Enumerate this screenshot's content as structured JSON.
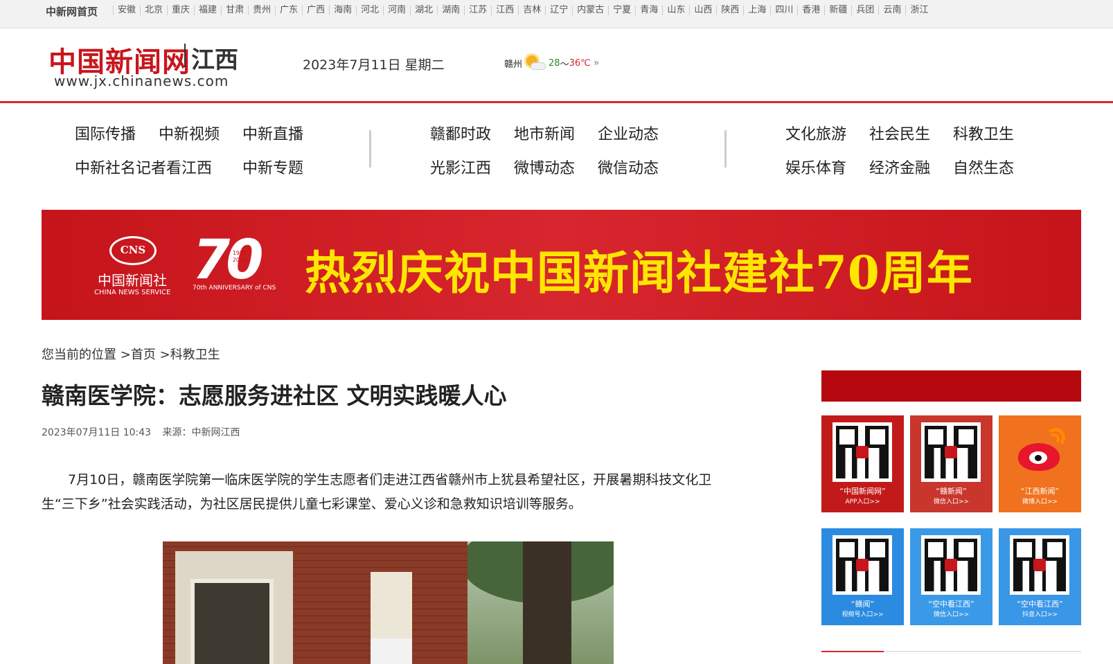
{
  "topbar": {
    "home_label": "中新网首页",
    "provinces": [
      "安徽",
      "北京",
      "重庆",
      "福建",
      "甘肃",
      "贵州",
      "广东",
      "广西",
      "海南",
      "河北",
      "河南",
      "湖北",
      "湖南",
      "江苏",
      "江西",
      "吉林",
      "辽宁",
      "内蒙古",
      "宁夏",
      "青海",
      "山东",
      "山西",
      "陕西",
      "上海",
      "四川",
      "香港",
      "新疆",
      "兵团",
      "云南",
      "浙江"
    ]
  },
  "header": {
    "logo_brand": "中国新闻网",
    "logo_region": "江西",
    "logo_url": "www.jx.chinanews.com",
    "date": "2023年7月11日 星期二",
    "weather": {
      "city": "赣州",
      "low": "28",
      "tilde": "～",
      "high": "36℃",
      "more": "»"
    }
  },
  "nav": {
    "items": [
      "国际传播",
      "中新视频",
      "中新直播",
      "中新社名记者看江西",
      "中新专题",
      "赣鄱时政",
      "地市新闻",
      "企业动态",
      "光影江西",
      "微博动态",
      "微信动态",
      "文化旅游",
      "社会民生",
      "科教卫生",
      "娱乐体育",
      "经济金融",
      "自然生态"
    ]
  },
  "banner": {
    "cns_abbr": "CNS",
    "cns_name": "中国新闻社",
    "cns_en": "CHINA NEWS SERVICE",
    "seventy": "70",
    "years": "1952 2022",
    "seventy_caption": "70th ANNIVERSARY of CNS",
    "headline": "热烈庆祝中国新闻社建社70周年"
  },
  "breadcrumb": {
    "prefix": "您当前的位置",
    "home": ">首页",
    "section": ">科教卫生"
  },
  "article": {
    "title": "赣南医学院：志愿服务进社区 文明实践暖人心",
    "datetime": "2023年07月11日 10:43",
    "source": "来源：中新网江西",
    "paragraph": "7月10日，赣南医学院第一临床医学院的学生志愿者们走进江西省赣州市上犹县希望社区，开展暑期科技文化卫生“三下乡”社会实践活动，为社区居民提供儿童七彩课堂、爱心义诊和急救知识培训等服务。"
  },
  "sidebar": {
    "tiles": [
      {
        "cap1": "“中国新闻网”",
        "cap2": "APP入口>>",
        "bg": "#c21a1a"
      },
      {
        "cap1": "“赣新闻”",
        "cap2": "微信入口>>",
        "bg": "#c8362c"
      },
      {
        "cap1": "“江西新闻”",
        "cap2": "微博入口>>",
        "bg": "#f0711e"
      },
      {
        "cap1": "“赣闻”",
        "cap2": "视频号入口>>",
        "bg": "#2a8be0"
      },
      {
        "cap1": "“空中看江西”",
        "cap2": "微信入口>>",
        "bg": "#3b9ae8"
      },
      {
        "cap1": "“空中看江西”",
        "cap2": "抖音入口>>",
        "bg": "#3a96e6"
      }
    ]
  }
}
